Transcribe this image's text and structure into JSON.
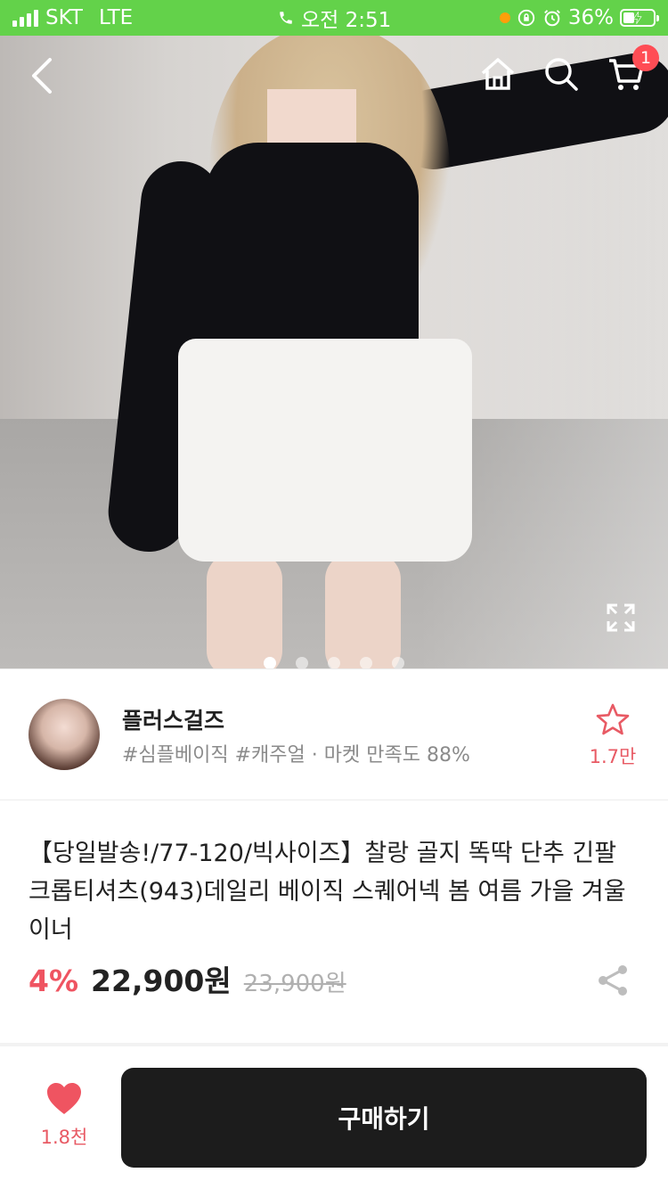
{
  "status_bar": {
    "carrier": "SKT",
    "network": "LTE",
    "time": "오전 2:51",
    "battery": "36%",
    "battery_level": 0.36,
    "icons": [
      "phone-icon",
      "orange-dot-icon",
      "lock-rotation-icon",
      "alarm-icon",
      "battery-icon"
    ]
  },
  "header": {
    "back_icon": "chevron-left-icon",
    "home_icon": "home-icon",
    "search_icon": "search-icon",
    "cart_icon": "cart-icon",
    "cart_badge": "1"
  },
  "gallery": {
    "image_count": 5,
    "current_index": 0,
    "expand_icon": "expand-icon"
  },
  "seller": {
    "name": "플러스걸즈",
    "tags": "#심플베이직 #캐주얼 · 마켓 만족도 88%",
    "favorite_count": "1.7만",
    "favorite_icon": "star-outline-icon"
  },
  "product": {
    "title": "【당일발송!/77-120/빅사이즈】찰랑 골지 똑딱 단추 긴팔 크롭티셔츠(943)데일리 베이직 스퀘어넥 봄 여름 가을 겨울 이너",
    "discount": "4%",
    "price": "22,900원",
    "original_price": "23,900원",
    "share_icon": "share-icon"
  },
  "bottom_bar": {
    "like_count": "1.8천",
    "like_icon": "heart-icon",
    "buy_label": "구매하기"
  },
  "colors": {
    "status_bar": "#63d24a",
    "accent": "#ef5461",
    "buy_button": "#1c1c1c"
  }
}
